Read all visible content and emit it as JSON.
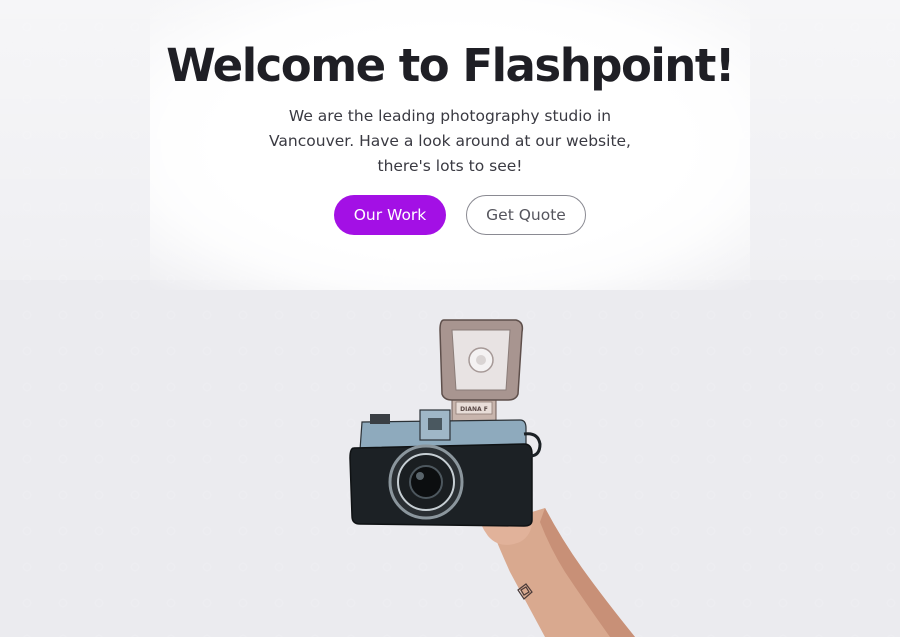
{
  "hero": {
    "title": "Welcome to Flashpoint!",
    "subtitle": "We are the leading photography studio in Vancouver. Have a look around at our website, there's lots to see!"
  },
  "actions": {
    "primary_label": "Our Work",
    "secondary_label": "Get Quote"
  },
  "image": {
    "subject": "hand-holding-camera",
    "flash_label": "DIANA F"
  },
  "colors": {
    "accent": "#a310e5",
    "title": "#1f1f25",
    "text": "#3a3a42",
    "pattern": "#e9e9ee"
  }
}
